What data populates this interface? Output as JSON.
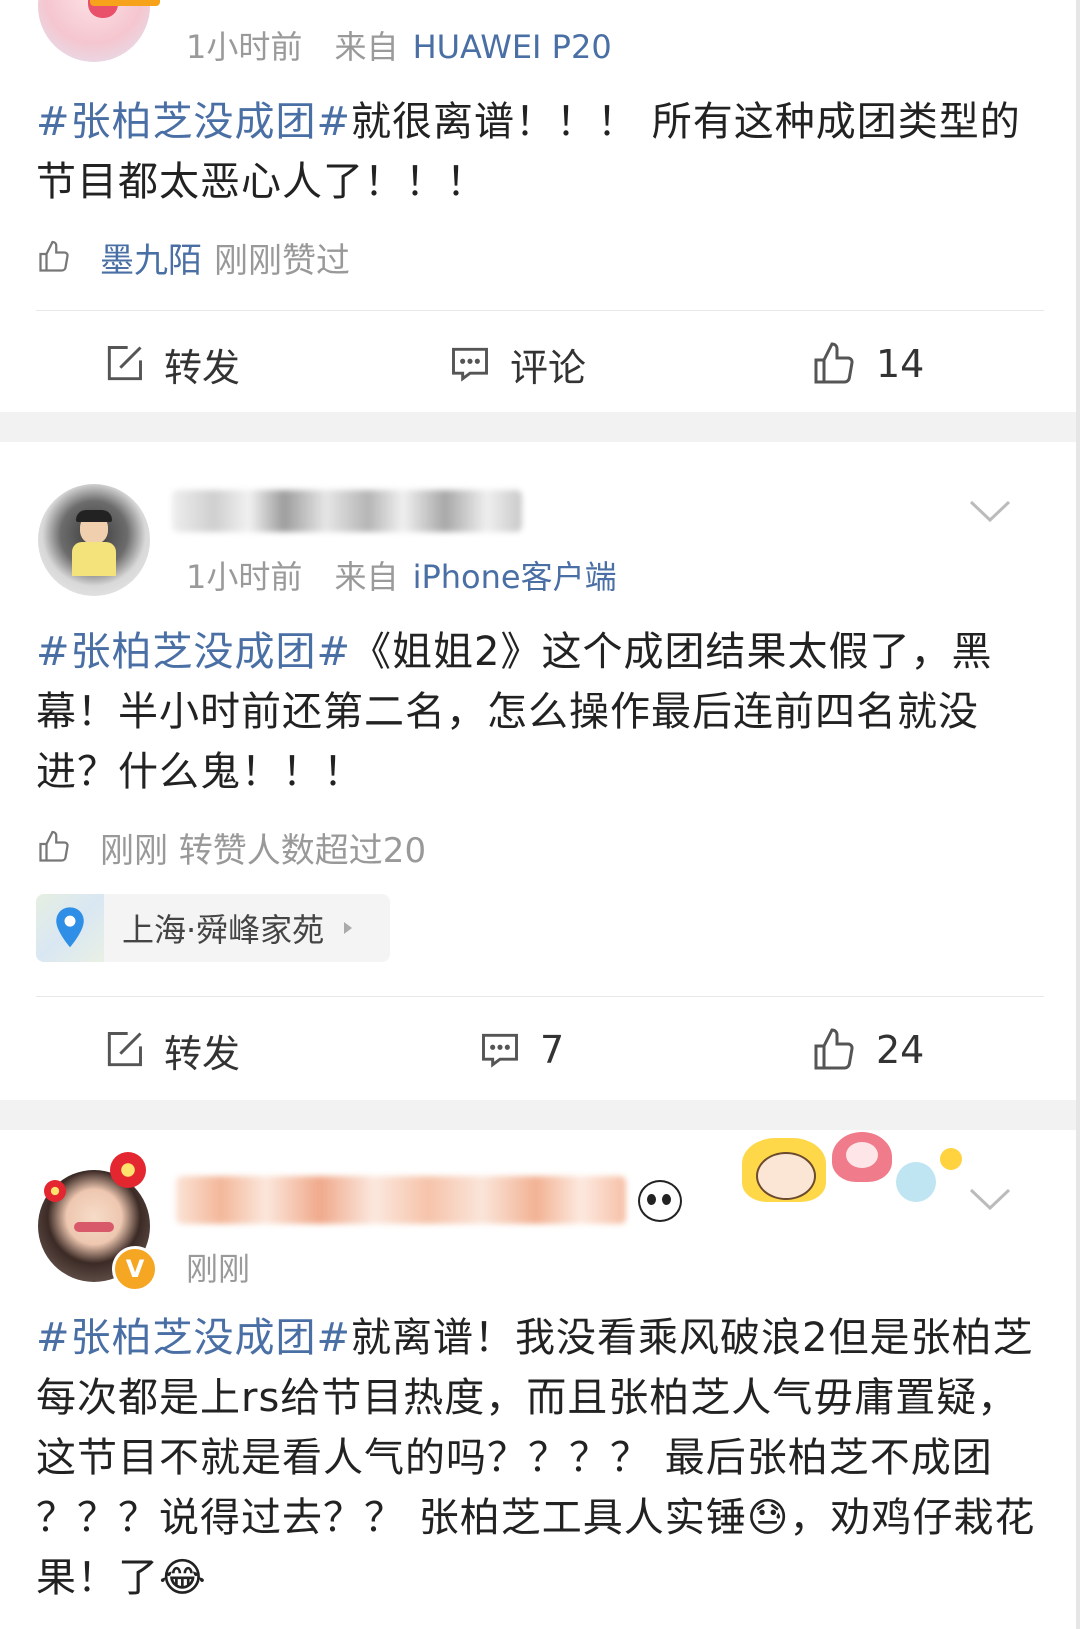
{
  "posts": [
    {
      "time": "1小时前",
      "source_prefix": "来自",
      "source": "HUAWEI P20",
      "tag": "#张柏芝没成团#",
      "text": "就很离谱！！！ 所有这种成团类型的节目都太恶心人了！！！",
      "liker": "墨九陌",
      "like_note": "刚刚赞过",
      "actions": {
        "repost": "转发",
        "comment": "评论",
        "like": "14"
      }
    },
    {
      "time": "1小时前",
      "source_prefix": "来自",
      "source": "iPhone客户端",
      "tag": "#张柏芝没成团#",
      "text": "《姐姐2》这个成团结果太假了，黑幕！半小时前还第二名，怎么操作最后连前四名就没进？什么鬼！！！",
      "like_note": "刚刚 转赞人数超过20",
      "location": "上海·舜峰家苑",
      "actions": {
        "repost": "转发",
        "comment": "7",
        "like": "24"
      }
    },
    {
      "time": "刚刚",
      "tag": "#张柏芝没成团#",
      "text": "就离谱！我没看乘风破浪2但是张柏芝每次都是上rs给节目热度，而且张柏芝人气毋庸置疑，这节目不就是看人气的吗？？？？ 最后张柏芝不成团 ？？？说得过去？？ 张柏芝工具人实锤😓，劝鸡仔栽花果！了😂"
    }
  ],
  "colors": {
    "link": "#4a6fa5",
    "meta": "#9a9a9a",
    "separator": "#f2f2f2"
  }
}
